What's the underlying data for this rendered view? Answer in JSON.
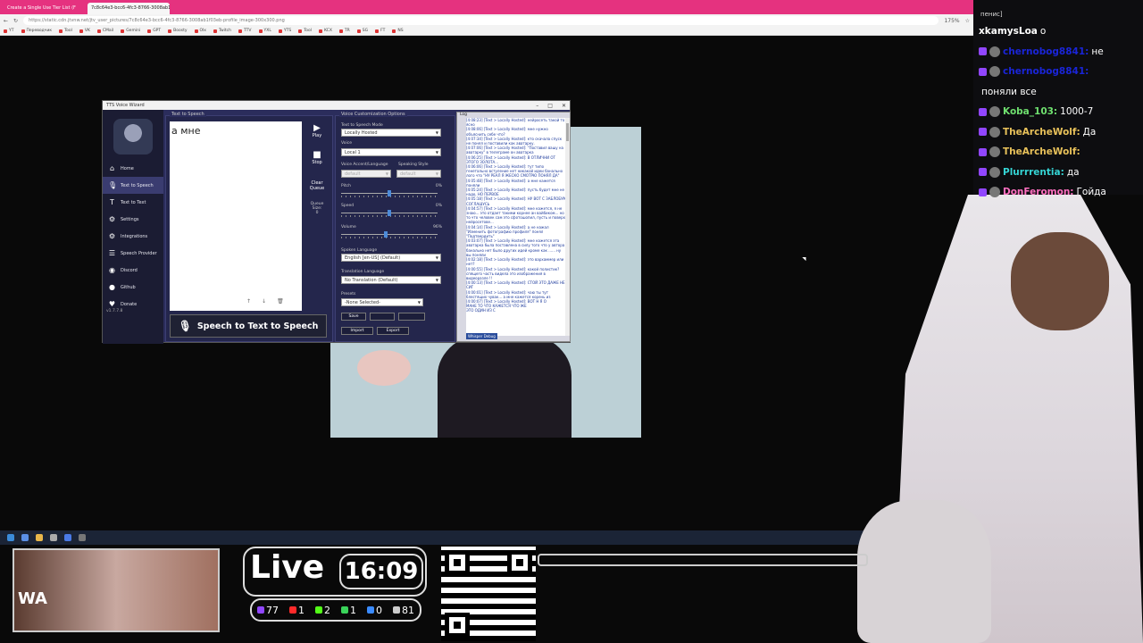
{
  "browser": {
    "tabs": [
      "Create a Single Use Tier List (F",
      "7c8c64e3-bcc6-4fc3-8766-3008ab1 ✕"
    ],
    "url": "https://static.cdn.jtvnw.net/jtv_user_pictures/7c8c64e3-bcc6-4fc3-8766-3008ab1f03eb-profile_image-300x300.png",
    "zoom": "175%",
    "bookmarks": [
      "YT",
      "Переводчик",
      "Tool",
      "VK",
      "CMail",
      "Gemini",
      "GPT",
      "Boosty",
      "Olx",
      "Twitch",
      "TTV",
      "YXL",
      "YTS",
      "Tool",
      "KCX",
      "TR",
      "SG",
      "FT",
      "NS"
    ]
  },
  "tts": {
    "title": "TTS Voice Wizard",
    "version": "v1.7.7.8",
    "nav": [
      {
        "label": "Home",
        "icon": "home-icon",
        "glyph": "⌂"
      },
      {
        "label": "Text to Speech",
        "icon": "microphone-icon",
        "glyph": "🎙"
      },
      {
        "label": "Text to Text",
        "icon": "text-icon",
        "glyph": "T"
      },
      {
        "label": "Settings",
        "icon": "gear-icon",
        "glyph": "⚙"
      },
      {
        "label": "Integrations",
        "icon": "integrations-icon",
        "glyph": "⚙"
      },
      {
        "label": "Speech Provider",
        "icon": "provider-icon",
        "glyph": "☰"
      },
      {
        "label": "Discord",
        "icon": "discord-icon",
        "glyph": "◉"
      },
      {
        "label": "Github",
        "icon": "github-icon",
        "glyph": "●"
      },
      {
        "label": "Donate",
        "icon": "donate-icon",
        "glyph": "♥"
      }
    ],
    "text_panel_label": "Text to Speech",
    "input_text": "а мне",
    "play_label": "Play",
    "stop_label": "Stop",
    "clear_label": "Clear Queue",
    "queue_label": "Queue Size:",
    "queue_size": "0",
    "speak_button": "Speech to Text to Speech",
    "voice_panel_label": "Voice Customization Options",
    "mode_label": "Text to Speech Mode",
    "mode_value": "Locally Hosted",
    "voice_label": "Voice",
    "voice_value": "Local 1",
    "accent_label": "Voice Accent/Language",
    "accent_value": "default",
    "style_label": "Speaking Style",
    "style_value": "default",
    "pitch_label": "Pitch",
    "pitch_value": "0%",
    "speed_label": "Speed",
    "speed_value": "0%",
    "volume_label": "Volume",
    "volume_value": "96%",
    "spoken_label": "Spoken Language",
    "spoken_value": "English [en-US] (Default)",
    "translation_label": "Translation Language",
    "translation_value": "No Translation (Default)",
    "presets_label": "Presets",
    "presets_value": "-None Selected-",
    "save_label": "Save",
    "import_label": "Import",
    "export_label": "Export",
    "log_label": "Log",
    "whisper_label": "Whisper Debug",
    "log_lines": [
      "[4:08:23] [Text > Locally Hosted]: нейросеть такой то ясно",
      "[4:08:06] [Text > Locally Hosted]: мне нужно объяснить себе что?",
      "[4:07:34] [Text > Locally Hosted]: кто скачала спуск не понял и поставили как аватарку.",
      "[4:07:06] [Text > Locally Hosted]: \"Поставил вашу на аватарку\" в телеграме он аватарка",
      "[4:06:25] [Text > Locally Hosted]: В ОТЛИЧНИ ОТ ЭТОГО ЗОЛОТА...",
      "[4:06:06] [Text > Locally Hosted]: тут типо генетально встуление нет никакой идеи банально лого что \"НУ РЕАЛ Я ЖЕСКО СМОТРЮ ПОНЯЛ ДА\"",
      "[4:05:48] [Text > Locally Hosted]: а мне кажется поняли",
      "[4:05:24] [Text > Locally Hosted]: пусть будет мне не надо, НО ПЕРВОЕ",
      "[4:05:18] [Text > Locally Hosted]: НУ ВОТ С ЗАБЛОБУМ СОГЛАШУСЬ",
      "[4:04:57] [Text > Locally Hosted]: мне кажется, я не знаю... это отдает такими корнее ан вайбиком... но то что человек сам это сфотошопил, пусть и поверх нейросетове...",
      "[4:04:14] [Text > Locally Hosted]: а не нажал \"Изменить фотографию профиля\" понял \"Подтвердить\"",
      "[4:03:07] [Text > Locally Hosted]: мне кажется эта аватарка была поставлена в силу того что у автора банально нет было других идей кроме как ...... ну вы поняли",
      "[4:02:18] [Text > Locally Hosted]: это вархаммер или нет?",
      "[4:00:55] [Text > Locally Hosted]: какой полистик? спящего часть видела это изображения в видеоразле !!",
      "[4:00:13] [Text > Locally Hosted]: СТОЙ ЭТО ДАЖЕ НЕ СИГ",
      "[4:00:01] [Text > Locally Hosted]: чаю ты тут блестящих чувак... а мне кажется корень из",
      "[4:00:07] [Text > Locally Hosted]: ВОТ Н Я О",
      "МАНЕ ТО ЧТО КАЖЕТСЯ ЧТО ЖЕ",
      "ЭТО ОДИН ИЗ С"
    ]
  },
  "chat": {
    "header": "пенис]",
    "messages": [
      {
        "user": "xkamysLoa",
        "text": "o",
        "color": "#ffffff",
        "has_badge": false
      },
      {
        "user": "chernobog8841:",
        "text": "не",
        "color": "#1a25d8",
        "has_badge": true
      },
      {
        "user": "chernobog8841:",
        "text": "",
        "color": "#1a25d8",
        "has_badge": true
      },
      {
        "user": "",
        "text": "поняли все",
        "color": "#ffffff",
        "has_badge": false
      },
      {
        "user": "Koba_103:",
        "text": "1000-7",
        "color": "#6fe06f",
        "has_badge": true
      },
      {
        "user": "TheArcheWolf:",
        "text": "Да",
        "color": "#e8c15a",
        "has_badge": true
      },
      {
        "user": "TheArcheWolf:",
        "text": "",
        "color": "#e8c15a",
        "has_badge": true
      },
      {
        "user": "Plurrrentia:",
        "text": "да",
        "color": "#35d4d4",
        "has_badge": true
      },
      {
        "user": "DonFeromon:",
        "text": "Гойда",
        "color": "#ff6fc0",
        "has_badge": true
      }
    ]
  },
  "overlay": {
    "webcam_text": "WA",
    "live_label": "Live",
    "live_time": "16:09",
    "stats": [
      {
        "value": "77",
        "color": "#9146ff",
        "icon": "twitch-icon"
      },
      {
        "value": "1",
        "color": "#ff2a2a",
        "icon": "youtube-icon"
      },
      {
        "value": "2",
        "color": "#53fc18",
        "icon": "kick-icon"
      },
      {
        "value": "1",
        "color": "#3ad35a",
        "icon": "rumble-icon"
      },
      {
        "value": "0",
        "color": "#3a8bff",
        "icon": "vk-icon"
      },
      {
        "value": "81",
        "color": "#cccccc",
        "icon": "viewers-icon"
      }
    ]
  }
}
